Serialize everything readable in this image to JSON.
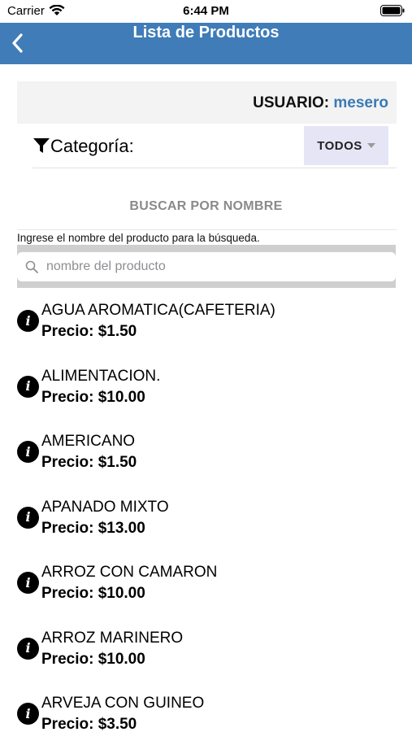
{
  "status_bar": {
    "carrier": "Carrier",
    "time": "6:44 PM"
  },
  "nav": {
    "title": "Lista de Productos",
    "back_icon": "chevron-left-icon"
  },
  "user": {
    "label": "USUARIO:",
    "value": "mesero"
  },
  "category": {
    "label": "Categoría:",
    "selected": "TODOS"
  },
  "search": {
    "header": "BUSCAR POR NOMBRE",
    "hint": "Ingrese el nombre del producto para la búsqueda.",
    "placeholder": "nombre del producto",
    "value": ""
  },
  "products": [
    {
      "name": "AGUA AROMATICA(CAFETERIA)",
      "price": "Precio: $1.50"
    },
    {
      "name": "ALIMENTACION.",
      "price": "Precio: $10.00"
    },
    {
      "name": "AMERICANO",
      "price": "Precio: $1.50"
    },
    {
      "name": "APANADO MIXTO",
      "price": "Precio: $13.00"
    },
    {
      "name": "ARROZ CON CAMARON",
      "price": "Precio: $10.00"
    },
    {
      "name": "ARROZ MARINERO",
      "price": "Precio: $10.00"
    },
    {
      "name": "ARVEJA CON GUINEO",
      "price": "Precio: $3.50"
    }
  ],
  "colors": {
    "nav_bg": "#3f7cb8",
    "user_value": "#3a7ab5",
    "select_bg": "#e5e5f6"
  }
}
